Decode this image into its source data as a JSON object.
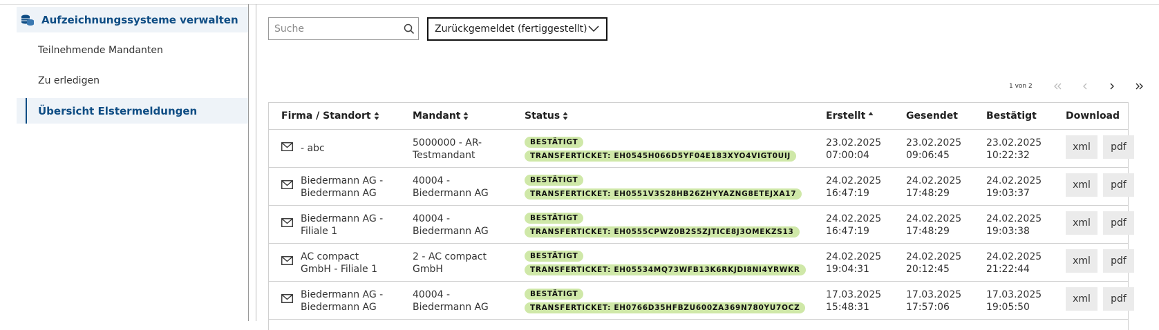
{
  "sidebar": {
    "header": "Aufzeichnungssysteme verwalten",
    "items": [
      {
        "label": "Teilnehmende Mandanten"
      },
      {
        "label": "Zu erledigen"
      },
      {
        "label": "Übersicht Elstermeldungen"
      }
    ]
  },
  "toolbar": {
    "search_placeholder": "Suche",
    "search_value": "",
    "filter_selected": "Zurückgemeldet (fertiggestellt)"
  },
  "pagination": {
    "info": "1 von 2"
  },
  "table": {
    "columns": {
      "firma": "Firma / Standort",
      "mandant": "Mandant",
      "status": "Status",
      "erstellt": "Erstellt",
      "gesendet": "Gesendet",
      "bestaetigt": "Bestätigt",
      "download": "Download"
    },
    "rows": [
      {
        "firma": [
          "- abc"
        ],
        "mandant": [
          "5000000 - AR-",
          "Testmandant"
        ],
        "status": "BESTÄTIGT",
        "ticket": "TRANSFERTICKET: EH0545H066D5YF04E183XYO4VIGT0UIJ",
        "erstellt": [
          "23.02.2025",
          "07:00:04"
        ],
        "gesendet": [
          "23.02.2025",
          "09:06:45"
        ],
        "bestaetigt": [
          "23.02.2025",
          "10:22:32"
        ],
        "xml": "xml",
        "pdf": "pdf"
      },
      {
        "firma": [
          "Biedermann AG -",
          "Biedermann AG"
        ],
        "mandant": [
          "40004 -",
          "Biedermann AG"
        ],
        "status": "BESTÄTIGT",
        "ticket": "TRANSFERTICKET: EH0551V3S28HB26ZHYYAZNG8ETEJXA17",
        "erstellt": [
          "24.02.2025",
          "16:47:19"
        ],
        "gesendet": [
          "24.02.2025",
          "17:48:29"
        ],
        "bestaetigt": [
          "24.02.2025",
          "19:03:37"
        ],
        "xml": "xml",
        "pdf": "pdf"
      },
      {
        "firma": [
          "Biedermann AG -",
          "Filiale 1"
        ],
        "mandant": [
          "40004 -",
          "Biedermann AG"
        ],
        "status": "BESTÄTIGT",
        "ticket": "TRANSFERTICKET: EH0555CPWZ0B2S5ZJTICE8J3OMEKZS13",
        "erstellt": [
          "24.02.2025",
          "16:47:19"
        ],
        "gesendet": [
          "24.02.2025",
          "17:48:29"
        ],
        "bestaetigt": [
          "24.02.2025",
          "19:03:38"
        ],
        "xml": "xml",
        "pdf": "pdf"
      },
      {
        "firma": [
          "AC compact",
          "GmbH - Filiale 1"
        ],
        "mandant": [
          "2 - AC compact",
          "GmbH"
        ],
        "status": "BESTÄTIGT",
        "ticket": "TRANSFERTICKET: EH05534MQ73WFB13K6RKJDI8NI4YRWKR",
        "erstellt": [
          "24.02.2025",
          "19:04:31"
        ],
        "gesendet": [
          "24.02.2025",
          "20:12:45"
        ],
        "bestaetigt": [
          "24.02.2025",
          "21:22:44"
        ],
        "xml": "xml",
        "pdf": "pdf"
      },
      {
        "firma": [
          "Biedermann AG -",
          "Biedermann AG"
        ],
        "mandant": [
          "40004 -",
          "Biedermann AG"
        ],
        "status": "BESTÄTIGT",
        "ticket": "TRANSFERTICKET: EH0766D35HFBZU600ZA369N780YU7OCZ",
        "erstellt": [
          "17.03.2025",
          "15:48:31"
        ],
        "gesendet": [
          "17.03.2025",
          "17:57:06"
        ],
        "bestaetigt": [
          "17.03.2025",
          "19:05:50"
        ],
        "xml": "xml",
        "pdf": "pdf"
      }
    ]
  },
  "icons": {
    "sidebar_header": "coins-stack-icon",
    "search": "search-icon",
    "filter": "chevron-down-icon",
    "row": "envelope-icon",
    "sort": "sort-icon",
    "sort_asc": "sort-up-icon",
    "pager": [
      "first-page-icon",
      "prev-page-icon",
      "next-page-icon",
      "last-page-icon"
    ]
  },
  "colors": {
    "accent": "#0f4d84",
    "badge": "#cfe8a8",
    "sidebar_active_bg": "#eef3f8",
    "button_bg": "#ebebeb"
  }
}
